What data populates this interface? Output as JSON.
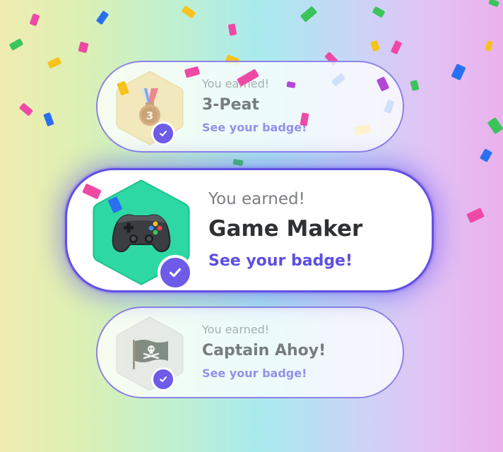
{
  "badges": [
    {
      "earned_label": "You earned!",
      "title": "3-Peat",
      "link_label": "See your badge!",
      "icon": "bronze-medal-3-icon",
      "hex_color": "#f1dc9c",
      "state": "faded"
    },
    {
      "earned_label": "You earned!",
      "title": "Game Maker",
      "link_label": "See your badge!",
      "icon": "game-controller-icon",
      "hex_color": "#2ed8a4",
      "state": "highlighted"
    },
    {
      "earned_label": "You earned!",
      "title": "Captain Ahoy!",
      "link_label": "See your badge!",
      "icon": "pirate-flag-icon",
      "hex_color": "#dde1dc",
      "state": "faded"
    }
  ],
  "colors": {
    "accent": "#6c5ce7",
    "link": "#5c4fe0",
    "title_text": "#2f3133",
    "muted_text": "#7b7e84"
  },
  "confetti_colors": [
    "#ee4aa5",
    "#2a6ff0",
    "#3bc45a",
    "#f7c21a",
    "#b248d6"
  ]
}
